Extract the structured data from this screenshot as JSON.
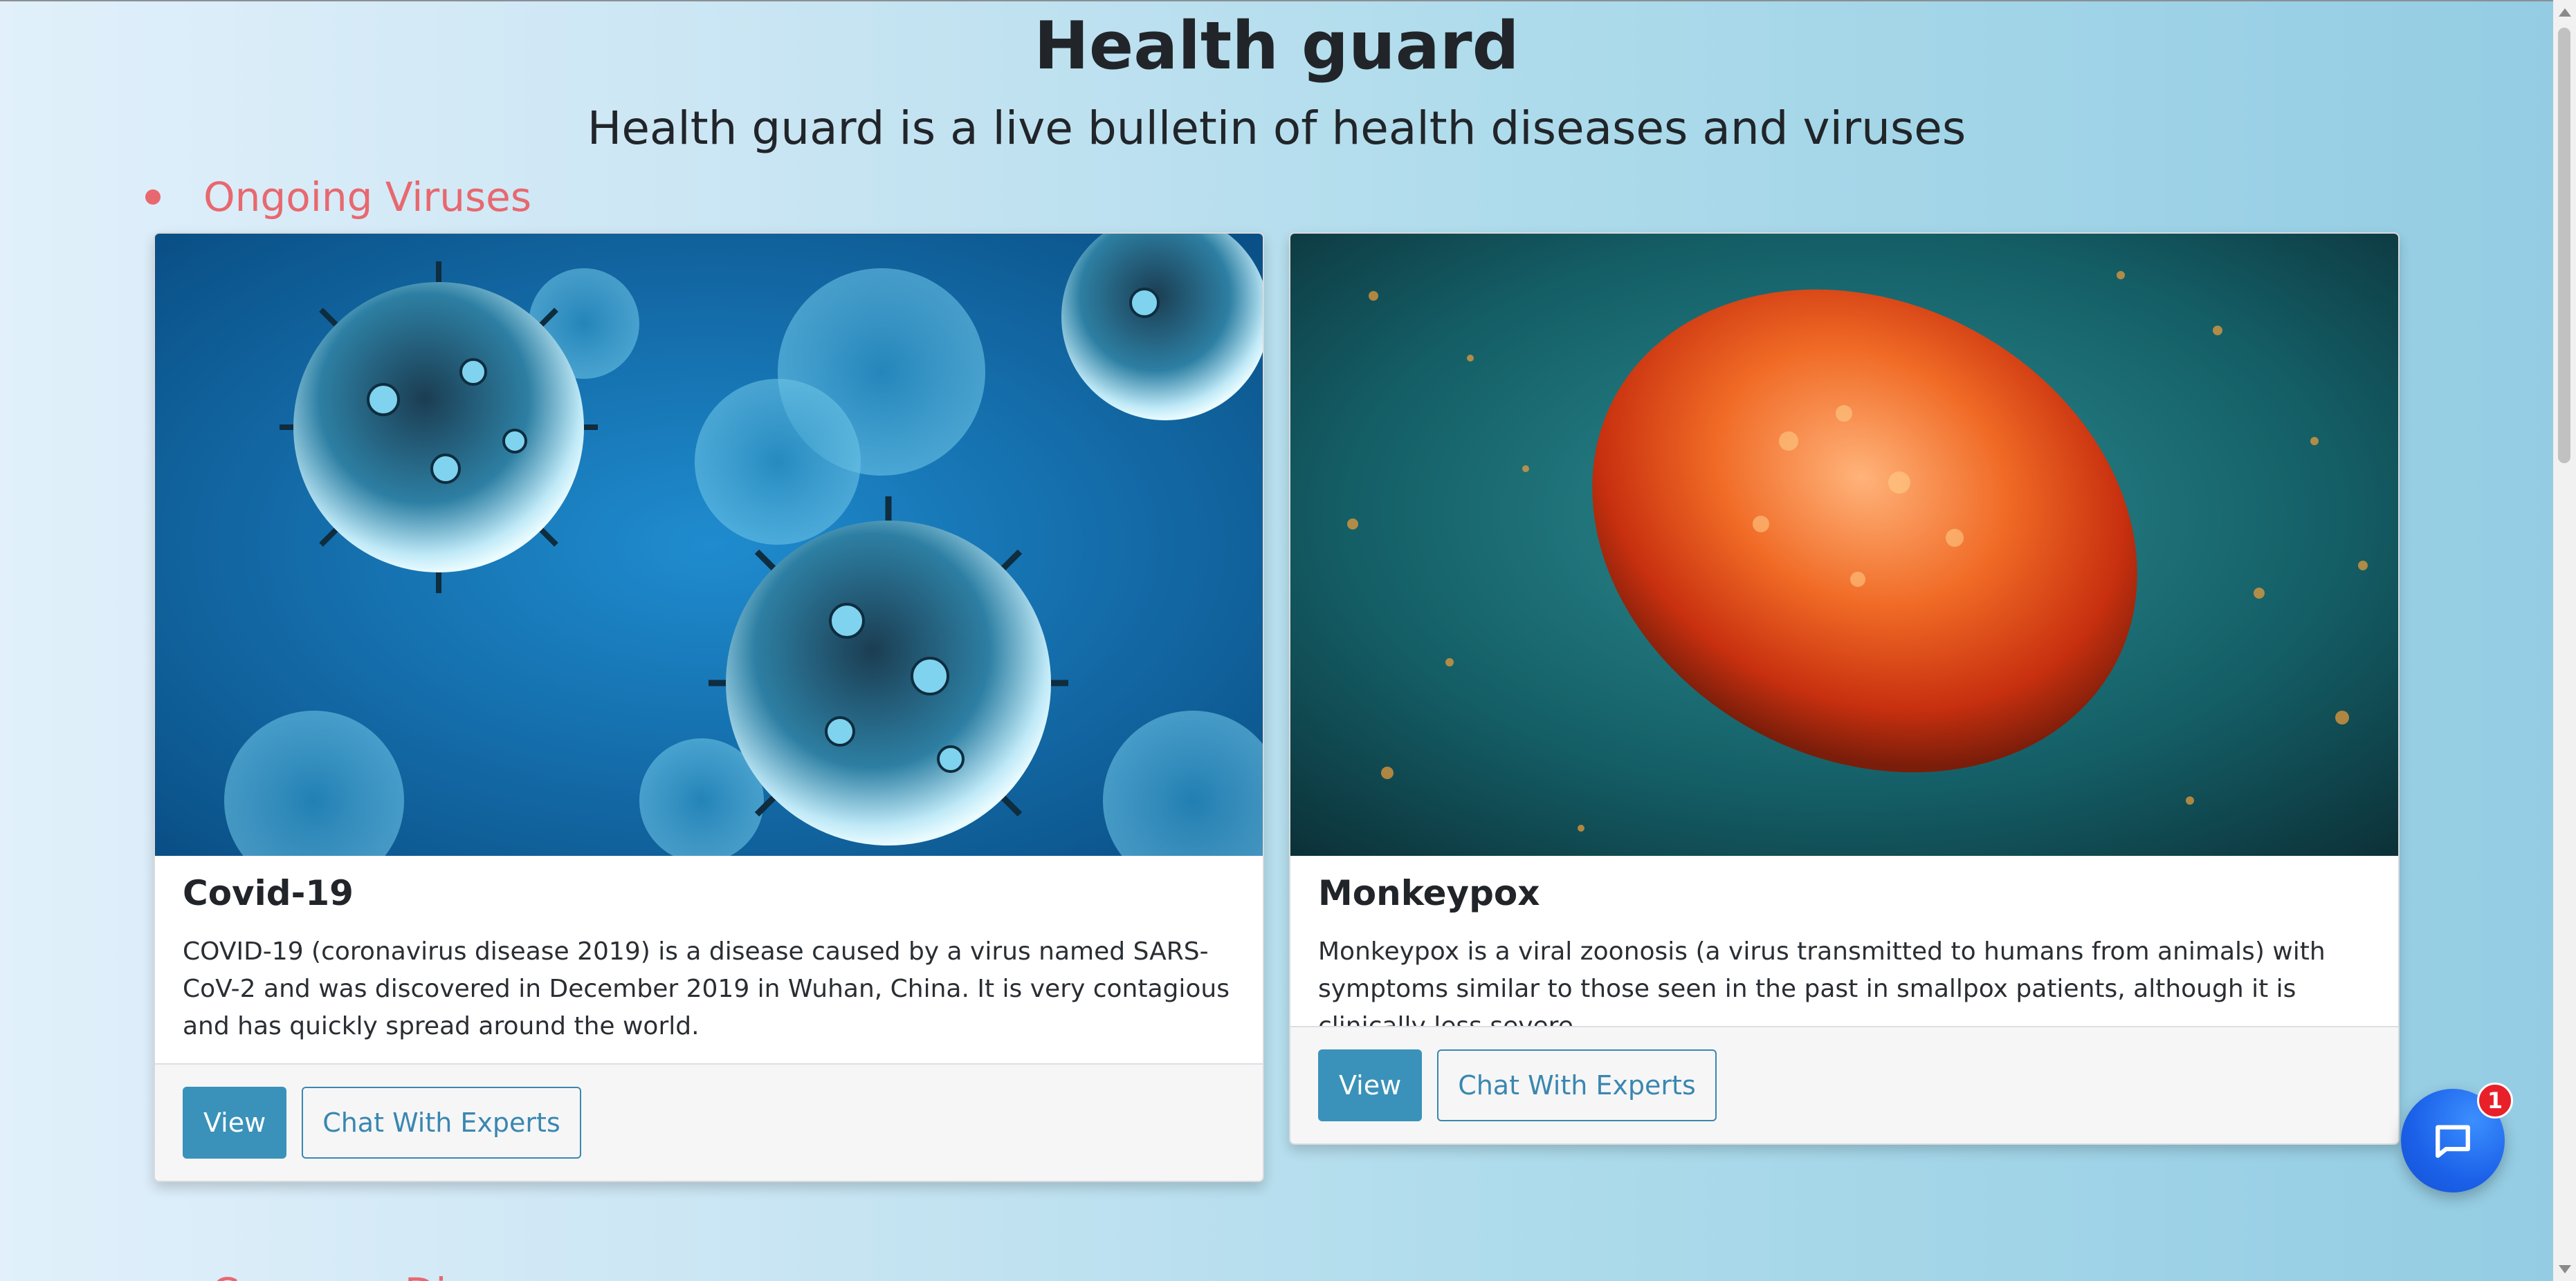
{
  "header": {
    "title": "Health guard",
    "subtitle": "Health guard is a live bulletin of health diseases and viruses"
  },
  "sections": {
    "ongoing": "Ongoing Viruses",
    "next_partial": "Common Dis"
  },
  "cards": [
    {
      "title": "Covid-19",
      "text": "COVID-19 (coronavirus disease 2019) is a disease caused by a virus named SARS-CoV-2 and was discovered in December 2019 in Wuhan, China. It is very contagious and has quickly spread around the world.",
      "view_label": "View",
      "chat_label": "Chat With Experts",
      "image_icon": "coronavirus-image"
    },
    {
      "title": "Monkeypox",
      "text": "Monkeypox is a viral zoonosis (a virus transmitted to humans from animals) with symptoms similar to those seen in the past in smallpox patients, although it is clinically less severe.",
      "view_label": "View",
      "chat_label": "Chat With Experts",
      "image_icon": "monkeypox-image"
    }
  ],
  "chat_widget": {
    "badge_count": "1",
    "icon": "chat-bubble-icon"
  },
  "colors": {
    "accent": "#e8686f",
    "primary_button": "#3a92ba",
    "chat_fab": "#1a60e8",
    "badge": "#e8202a"
  }
}
